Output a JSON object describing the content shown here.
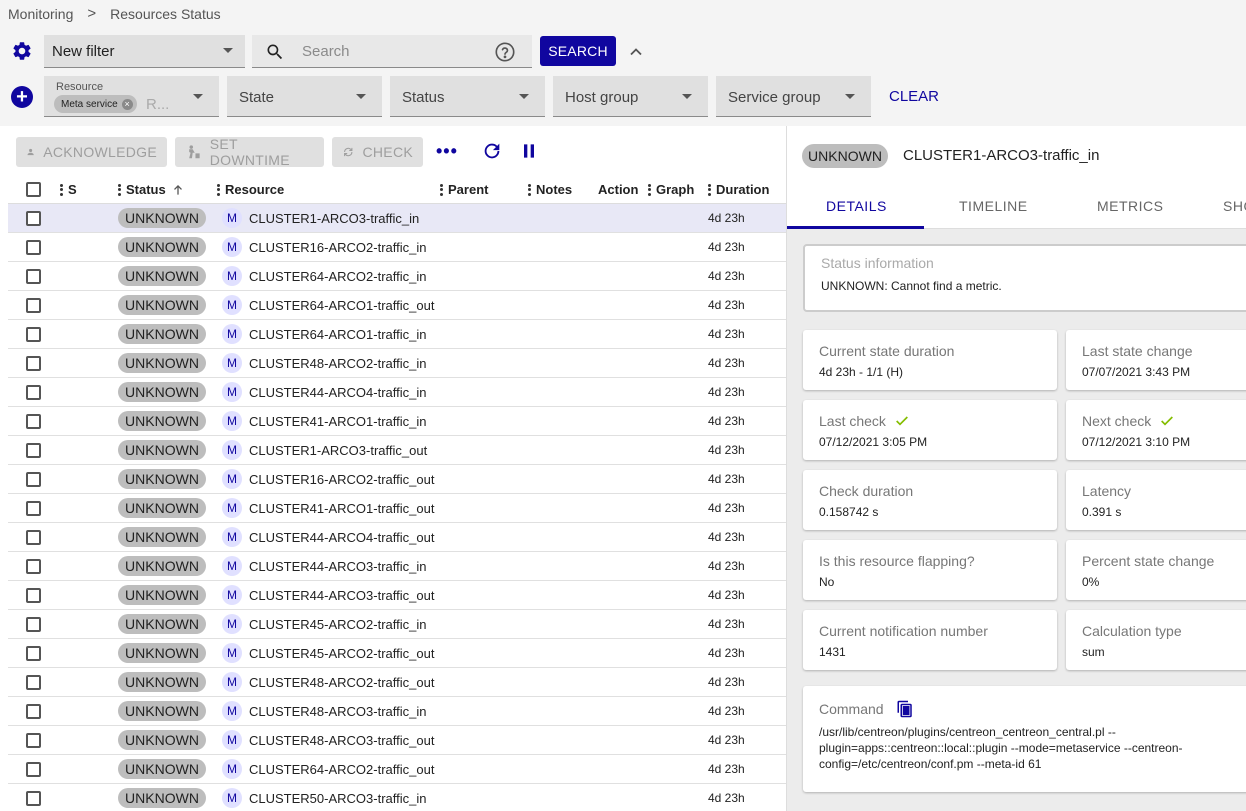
{
  "breadcrumb": {
    "items": [
      "Monitoring",
      "Resources Status"
    ],
    "separator": ">"
  },
  "filter": {
    "selected": "New filter"
  },
  "search": {
    "placeholder": "Search",
    "button_label": "SEARCH"
  },
  "criteria": {
    "resource": {
      "label": "Resource",
      "chip": "Meta service",
      "more": "R..."
    },
    "state": "State",
    "status": "Status",
    "host_group": "Host group",
    "service_group": "Service group",
    "clear_label": "CLEAR"
  },
  "actions": {
    "acknowledge": "ACKNOWLEDGE",
    "set_downtime": "SET DOWNTIME",
    "check": "CHECK",
    "more": "•••"
  },
  "table": {
    "columns": [
      "S",
      "Status",
      "Resource",
      "Parent",
      "Notes",
      "Action",
      "Graph",
      "Duration"
    ],
    "rows": [
      {
        "status": "UNKNOWN",
        "type": "M",
        "resource": "CLUSTER1-ARCO3-traffic_in",
        "duration": "4d 23h"
      },
      {
        "status": "UNKNOWN",
        "type": "M",
        "resource": "CLUSTER16-ARCO2-traffic_in",
        "duration": "4d 23h"
      },
      {
        "status": "UNKNOWN",
        "type": "M",
        "resource": "CLUSTER64-ARCO2-traffic_in",
        "duration": "4d 23h"
      },
      {
        "status": "UNKNOWN",
        "type": "M",
        "resource": "CLUSTER64-ARCO1-traffic_out",
        "duration": "4d 23h"
      },
      {
        "status": "UNKNOWN",
        "type": "M",
        "resource": "CLUSTER64-ARCO1-traffic_in",
        "duration": "4d 23h"
      },
      {
        "status": "UNKNOWN",
        "type": "M",
        "resource": "CLUSTER48-ARCO2-traffic_in",
        "duration": "4d 23h"
      },
      {
        "status": "UNKNOWN",
        "type": "M",
        "resource": "CLUSTER44-ARCO4-traffic_in",
        "duration": "4d 23h"
      },
      {
        "status": "UNKNOWN",
        "type": "M",
        "resource": "CLUSTER41-ARCO1-traffic_in",
        "duration": "4d 23h"
      },
      {
        "status": "UNKNOWN",
        "type": "M",
        "resource": "CLUSTER1-ARCO3-traffic_out",
        "duration": "4d 23h"
      },
      {
        "status": "UNKNOWN",
        "type": "M",
        "resource": "CLUSTER16-ARCO2-traffic_out",
        "duration": "4d 23h"
      },
      {
        "status": "UNKNOWN",
        "type": "M",
        "resource": "CLUSTER41-ARCO1-traffic_out",
        "duration": "4d 23h"
      },
      {
        "status": "UNKNOWN",
        "type": "M",
        "resource": "CLUSTER44-ARCO4-traffic_out",
        "duration": "4d 23h"
      },
      {
        "status": "UNKNOWN",
        "type": "M",
        "resource": "CLUSTER44-ARCO3-traffic_in",
        "duration": "4d 23h"
      },
      {
        "status": "UNKNOWN",
        "type": "M",
        "resource": "CLUSTER44-ARCO3-traffic_out",
        "duration": "4d 23h"
      },
      {
        "status": "UNKNOWN",
        "type": "M",
        "resource": "CLUSTER45-ARCO2-traffic_in",
        "duration": "4d 23h"
      },
      {
        "status": "UNKNOWN",
        "type": "M",
        "resource": "CLUSTER45-ARCO2-traffic_out",
        "duration": "4d 23h"
      },
      {
        "status": "UNKNOWN",
        "type": "M",
        "resource": "CLUSTER48-ARCO2-traffic_out",
        "duration": "4d 23h"
      },
      {
        "status": "UNKNOWN",
        "type": "M",
        "resource": "CLUSTER48-ARCO3-traffic_in",
        "duration": "4d 23h"
      },
      {
        "status": "UNKNOWN",
        "type": "M",
        "resource": "CLUSTER48-ARCO3-traffic_out",
        "duration": "4d 23h"
      },
      {
        "status": "UNKNOWN",
        "type": "M",
        "resource": "CLUSTER64-ARCO2-traffic_out",
        "duration": "4d 23h"
      },
      {
        "status": "UNKNOWN",
        "type": "M",
        "resource": "CLUSTER50-ARCO3-traffic_in",
        "duration": "4d 23h"
      }
    ]
  },
  "details": {
    "status": "UNKNOWN",
    "name": "CLUSTER1-ARCO3-traffic_in",
    "tabs": [
      "DETAILS",
      "TIMELINE",
      "METRICS",
      "SHO"
    ],
    "status_info": {
      "title": "Status information",
      "value": "UNKNOWN: Cannot find a metric."
    },
    "current_state_duration": {
      "title": "Current state duration",
      "value": "4d 23h - 1/1 (H)"
    },
    "last_state_change": {
      "title": "Last state change",
      "value": "07/07/2021 3:43 PM"
    },
    "last_check": {
      "title": "Last check",
      "value": "07/12/2021 3:05 PM"
    },
    "next_check": {
      "title": "Next check",
      "value": "07/12/2021 3:10 PM"
    },
    "check_duration": {
      "title": "Check duration",
      "value": "0.158742 s"
    },
    "latency": {
      "title": "Latency",
      "value": "0.391 s"
    },
    "flapping": {
      "title": "Is this resource flapping?",
      "value": "No"
    },
    "percent_state_change": {
      "title": "Percent state change",
      "value": "0%"
    },
    "notification_number": {
      "title": "Current notification number",
      "value": "1431"
    },
    "calculation_type": {
      "title": "Calculation type",
      "value": "sum"
    },
    "command": {
      "title": "Command",
      "value": "/usr/lib/centreon/plugins/centreon_centreon_central.pl --plugin=apps::centreon::local::plugin --mode=metaservice --centreon-config=/etc/centreon/conf.pm --meta-id 61"
    }
  },
  "colors": {
    "primary": "#10069f",
    "unknown_badge": "#bdbdbd",
    "check_ok": "#84bd00"
  }
}
